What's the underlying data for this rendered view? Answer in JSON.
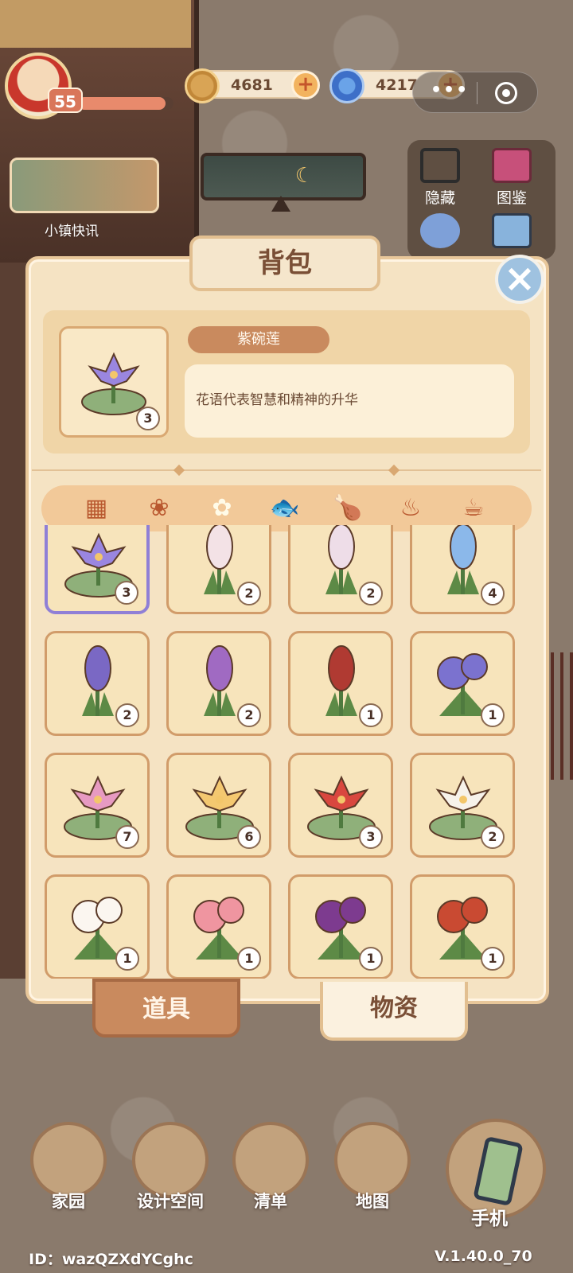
{
  "hud": {
    "level": "55",
    "xp_fraction": 0.92,
    "coins": "4681",
    "gems": "4217",
    "mini_menu_dots": "•••"
  },
  "left_widgets": {
    "news_label": "小镇快讯"
  },
  "right_panel": {
    "hide_label": "隐藏",
    "catalog_label": "图鉴"
  },
  "backpack": {
    "title": "背包",
    "selected_item": {
      "name": "紫碗莲",
      "description": "花语代表智慧和精神的升华",
      "count": "3"
    },
    "categories": [
      {
        "name": "all",
        "icon": "grid-icon"
      },
      {
        "name": "seeds",
        "icon": "seed-bag-icon"
      },
      {
        "name": "flowers",
        "icon": "sprout-icon",
        "active": true
      },
      {
        "name": "fish",
        "icon": "fish-icon"
      },
      {
        "name": "meat",
        "icon": "drumstick-icon"
      },
      {
        "name": "dishes",
        "icon": "bowl-icon"
      },
      {
        "name": "drinks",
        "icon": "tea-cup-icon"
      }
    ],
    "items": [
      {
        "flower": "purple-lotus",
        "count": "3",
        "petal": "#9a86e0",
        "selected": true
      },
      {
        "flower": "white-hyacinth",
        "count": "2",
        "petal": "#f3e2e6"
      },
      {
        "flower": "white-hyacinth-2",
        "count": "2",
        "petal": "#eedde8"
      },
      {
        "flower": "blue-hyacinth",
        "count": "4",
        "petal": "#8bb8ea"
      },
      {
        "flower": "blue-purple-hyacinth",
        "count": "2",
        "petal": "#7a68c4"
      },
      {
        "flower": "purple-hyacinth",
        "count": "2",
        "petal": "#a06ac2"
      },
      {
        "flower": "red-hyacinth",
        "count": "1",
        "petal": "#b03a32"
      },
      {
        "flower": "blue-peony",
        "count": "1",
        "petal": "#7b72cf"
      },
      {
        "flower": "pink-lotus",
        "count": "7",
        "petal": "#e79ac2"
      },
      {
        "flower": "yellow-lotus",
        "count": "6",
        "petal": "#f4c870"
      },
      {
        "flower": "red-lotus",
        "count": "3",
        "petal": "#d9473f"
      },
      {
        "flower": "white-lotus",
        "count": "2",
        "petal": "#f7f2ea"
      },
      {
        "flower": "white-lily",
        "count": "1",
        "petal": "#fbf6f0"
      },
      {
        "flower": "pink-camellia",
        "count": "1",
        "petal": "#ef95a0"
      },
      {
        "flower": "purple-peony",
        "count": "1",
        "petal": "#7d3b8f"
      },
      {
        "flower": "red-spider-lily",
        "count": "1",
        "petal": "#c94a32"
      }
    ],
    "tabs": {
      "tools": "道具",
      "materials": "物资"
    }
  },
  "bottom_nav": {
    "home": "家园",
    "design": "设计空间",
    "list": "清单",
    "map": "地图",
    "phone": "手机"
  },
  "footer": {
    "user_id": "ID：wazQZXdYCghc",
    "version": "V.1.40.0_70"
  }
}
